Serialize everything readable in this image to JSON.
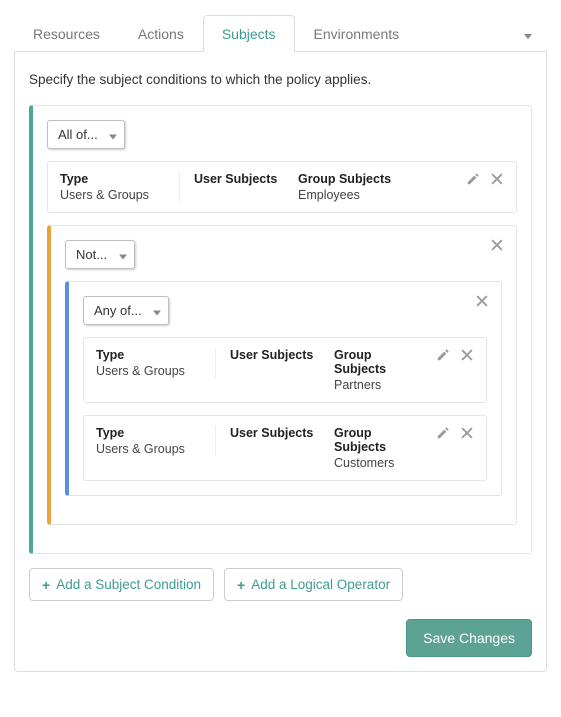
{
  "tabs": {
    "resources": "Resources",
    "actions": "Actions",
    "subjects": "Subjects",
    "environments": "Environments"
  },
  "intro": "Specify the subject conditions to which the policy applies.",
  "operators": {
    "all_of": "All of...",
    "not": "Not...",
    "any_of": "Any of..."
  },
  "labels": {
    "type_h": "Type",
    "users_h": "User Subjects",
    "groups_h": "Group Subjects"
  },
  "root": {
    "op": "all_of",
    "rows": [
      {
        "type": "Users & Groups",
        "users": "",
        "groups": "Employees"
      }
    ],
    "child": {
      "op": "not",
      "child": {
        "op": "any_of",
        "rows": [
          {
            "type": "Users & Groups",
            "users": "",
            "groups": "Partners"
          },
          {
            "type": "Users & Groups",
            "users": "",
            "groups": "Customers"
          }
        ]
      }
    }
  },
  "buttons": {
    "add_condition": "Add a Subject Condition",
    "add_operator": "Add a Logical Operator",
    "save": "Save Changes"
  }
}
